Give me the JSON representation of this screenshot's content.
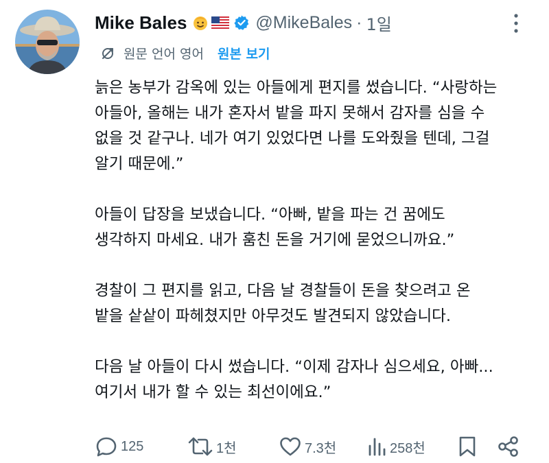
{
  "author": {
    "name": "Mike Bales",
    "handle": "@MikeBales",
    "separator": "·",
    "time": "1일"
  },
  "translation": {
    "note": "원문 언어 영어",
    "show_original_label": "원본 보기"
  },
  "tweet": {
    "paragraphs": [
      [
        "늙은 농부가 감옥에 있는 아들에게 편지를 썼습니다. “사랑하는",
        "아들아, 올해는 내가 혼자서 밭을 파지 못해서 감자를 심을 수",
        "없을 것 같구나. 네가 여기 있었다면 나를 도와줬을 텐데, 그걸",
        "알기 때문에.”"
      ],
      [
        "아들이 답장을 보냈습니다. “아빠, 밭을 파는 건 꿈에도",
        "생각하지 마세요. 내가 훔친 돈을 거기에 묻었으니까요.”"
      ],
      [
        "경찰이 그 편지를 읽고, 다음 날 경찰들이 돈을 찾으려고 온",
        "밭을 샅샅이 파헤쳤지만 아무것도 발견되지 않았습니다."
      ],
      [
        "다음 날 아들이 다시 썼습니다. “이제 감자나 심으세요, 아빠...",
        "여기서 내가 할 수 있는 최선이에요.”"
      ]
    ]
  },
  "metrics": {
    "replies": "125",
    "retweets": "1천",
    "likes": "7.3천",
    "views": "258천"
  },
  "icons": {
    "header": [
      "smiling-face-emoji-icon",
      "us-flag-icon",
      "verified-badge-icon",
      "more-vertical-icon"
    ],
    "translate": "translate-icon",
    "actions": [
      "reply-icon",
      "retweet-icon",
      "like-icon",
      "views-icon",
      "bookmark-icon",
      "share-icon"
    ]
  },
  "colors": {
    "text": "#0f1419",
    "secondary": "#536471",
    "accent": "#1d9bf0"
  }
}
